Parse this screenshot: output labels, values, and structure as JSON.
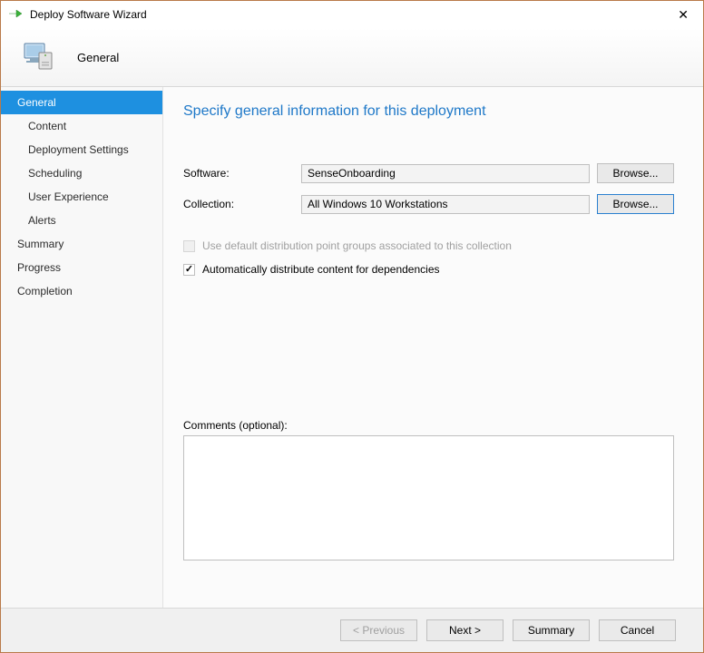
{
  "titlebar": {
    "title": "Deploy Software Wizard"
  },
  "header": {
    "title": "General"
  },
  "sidebar": {
    "items": [
      {
        "label": "General",
        "selected": true,
        "child": false
      },
      {
        "label": "Content",
        "selected": false,
        "child": true
      },
      {
        "label": "Deployment Settings",
        "selected": false,
        "child": true
      },
      {
        "label": "Scheduling",
        "selected": false,
        "child": true
      },
      {
        "label": "User Experience",
        "selected": false,
        "child": true
      },
      {
        "label": "Alerts",
        "selected": false,
        "child": true
      },
      {
        "label": "Summary",
        "selected": false,
        "child": false
      },
      {
        "label": "Progress",
        "selected": false,
        "child": false
      },
      {
        "label": "Completion",
        "selected": false,
        "child": false
      }
    ]
  },
  "main": {
    "heading": "Specify general information for this deployment",
    "software_label": "Software:",
    "software_value": "SenseOnboarding",
    "software_browse": "Browse...",
    "collection_label": "Collection:",
    "collection_value": "All Windows 10 Workstations",
    "collection_browse": "Browse...",
    "cb1_label": "Use default distribution point groups associated to this collection",
    "cb2_label": "Automatically distribute content for dependencies",
    "comments_label": "Comments (optional):",
    "comments_value": ""
  },
  "footer": {
    "previous": "< Previous",
    "next": "Next >",
    "summary": "Summary",
    "cancel": "Cancel"
  }
}
